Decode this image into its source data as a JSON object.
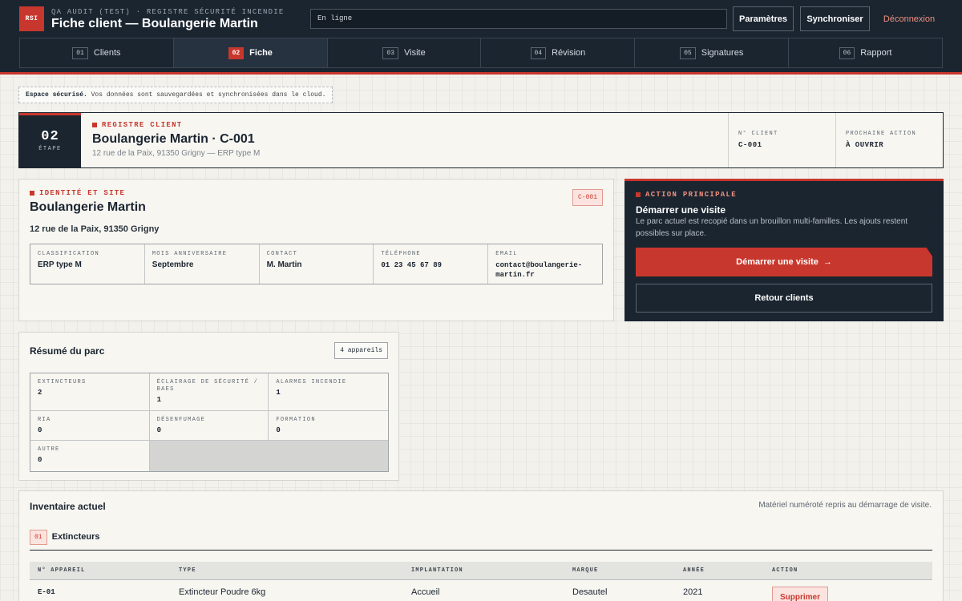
{
  "header": {
    "logo": "RSI",
    "subtitle": "QA AUDIT (TEST) · REGISTRE SÉCURITÉ INCENDIE",
    "title": "Fiche client — Boulangerie Martin",
    "status": "En ligne",
    "params_label": "Paramètres",
    "sync_label": "Synchroniser",
    "logout_label": "Déconnexion"
  },
  "steps": [
    {
      "num": "01",
      "label": "Clients"
    },
    {
      "num": "02",
      "label": "Fiche"
    },
    {
      "num": "03",
      "label": "Visite"
    },
    {
      "num": "04",
      "label": "Révision"
    },
    {
      "num": "05",
      "label": "Signatures"
    },
    {
      "num": "06",
      "label": "Rapport"
    }
  ],
  "notice": {
    "bold": "Espace sécurisé.",
    "text": " Vos données sont sauvegardées et synchronisées dans le cloud."
  },
  "banner": {
    "step_num": "02",
    "step_label": "ÉTAPE",
    "kicker": "REGISTRE CLIENT",
    "title": "Boulangerie Martin · C-001",
    "subtitle": "12 rue de la Paix, 91350 Grigny — ERP type M",
    "client_no_label": "N° CLIENT",
    "client_no": "C-001",
    "next_action_label": "PROCHAINE ACTION",
    "next_action": "À OUVRIR"
  },
  "identity": {
    "kicker": "IDENTITÉ ET SITE",
    "name": "Boulangerie Martin",
    "address": "12 rue de la Paix, 91350 Grigny",
    "badge": "C-001",
    "fields": [
      {
        "label": "CLASSIFICATION",
        "value": "ERP type M"
      },
      {
        "label": "MOIS ANNIVERSAIRE",
        "value": "Septembre"
      },
      {
        "label": "CONTACT",
        "value": "M. Martin"
      },
      {
        "label": "TÉLÉPHONE",
        "value": "01 23 45 67 89"
      },
      {
        "label": "EMAIL",
        "value": "contact@boulangerie-martin.fr"
      }
    ]
  },
  "action": {
    "kicker": "ACTION PRINCIPALE",
    "title": "Démarrer une visite",
    "description": "Le parc actuel est recopié dans un brouillon multi-familles. Les ajouts restent possibles sur place.",
    "primary_label": "Démarrer une visite",
    "primary_arrow": "→",
    "secondary_label": "Retour clients"
  },
  "summary": {
    "title": "Résumé du parc",
    "count": "4 appareils",
    "items": [
      {
        "label": "EXTINCTEURS",
        "value": "2"
      },
      {
        "label": "ÉCLAIRAGE DE SÉCURITÉ / BAES",
        "value": "1"
      },
      {
        "label": "ALARMES INCENDIE",
        "value": "1"
      },
      {
        "label": "RIA",
        "value": "0"
      },
      {
        "label": "DÉSENFUMAGE",
        "value": "0"
      },
      {
        "label": "FORMATION",
        "value": "0"
      },
      {
        "label": "AUTRE",
        "value": "0"
      }
    ]
  },
  "inventory": {
    "title": "Inventaire actuel",
    "note": "Matériel numéroté repris au démarrage de visite.",
    "family_num": "01",
    "family_label": "Extincteurs",
    "columns": [
      "N° APPAREIL",
      "TYPE",
      "IMPLANTATION",
      "MARQUE",
      "ANNÉE",
      "ACTION"
    ],
    "rows": [
      {
        "id": "E-01",
        "type": "Extincteur Poudre 6kg",
        "location": "Accueil",
        "brand": "Desautel",
        "year": "2021",
        "action": "Supprimer"
      }
    ]
  },
  "colors": {
    "navy": "#1b2530",
    "accent_red": "#c8372d",
    "paper": "#f2f1ec"
  }
}
